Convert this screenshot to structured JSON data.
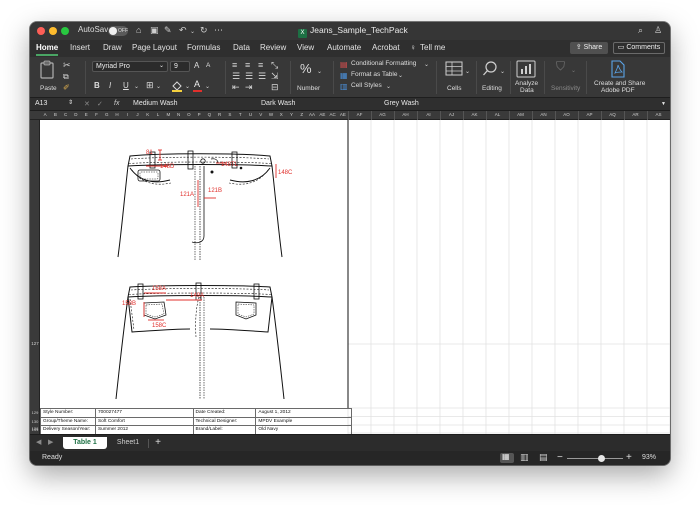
{
  "titlebar": {
    "autosave_label": "AutoSave",
    "autosave_state": "OFF",
    "document_title": "Jeans_Sample_TechPack",
    "window_buttons_colors": [
      "#fe5f57",
      "#febc2e",
      "#28c840"
    ]
  },
  "menu": {
    "tabs": [
      "Home",
      "Insert",
      "Draw",
      "Page Layout",
      "Formulas",
      "Data",
      "Review",
      "View",
      "Automate",
      "Acrobat"
    ],
    "tell_me": "Tell me",
    "share": "Share",
    "comments": "Comments",
    "accent_color": "#4aa564"
  },
  "ribbon": {
    "paste": "Paste",
    "font_name": "Myriad Pro",
    "font_size": "9",
    "bold": "B",
    "italic": "I",
    "underline": "U",
    "grow_font": "A",
    "shrink_font": "A",
    "number": "Number",
    "percent": "%",
    "conditional_formatting": "Conditional Formatting",
    "format_as_table": "Format as Table",
    "cell_styles": "Cell Styles",
    "cells": "Cells",
    "editing": "Editing",
    "analyze_data": [
      "Analyze",
      "Data"
    ],
    "sensitivity": "Sensitivity",
    "create_share": [
      "Create and Share",
      "Adobe PDF"
    ]
  },
  "formula_bar": {
    "name_box": "A13",
    "fx": "fx",
    "cells": [
      "Medium Wash",
      "Dark Wash",
      "Grey Wash"
    ]
  },
  "columns": {
    "left": [
      "A",
      "B",
      "C",
      "D",
      "E",
      "F",
      "G",
      "H",
      "I",
      "J",
      "K",
      "L",
      "M",
      "N",
      "O",
      "P",
      "Q",
      "R",
      "S",
      "T",
      "U",
      "V",
      "W",
      "X",
      "Y",
      "Z",
      "AA",
      "AE",
      "AC",
      "AE"
    ],
    "right": [
      "AF",
      "AG",
      "AH",
      "AI",
      "AJ",
      "AK",
      "AL",
      "AM",
      "AN",
      "AO",
      "AP",
      "AQ",
      "AR",
      "AS"
    ]
  },
  "rows": [
    "127",
    "128",
    "129",
    "130",
    "131"
  ],
  "sketch_labels": {
    "front": [
      "81",
      "148D",
      "148TL",
      "148C",
      "121A",
      "121B"
    ],
    "back": [
      "158A",
      "158B",
      "149A",
      "158C"
    ]
  },
  "spec_table": [
    {
      "label1": "Style Number:",
      "value1": "700027477",
      "label2": "Date Created:",
      "value2": "August 1, 2012"
    },
    {
      "label1": "Group/Theme Name:",
      "value1": "Soft Comfort",
      "label2": "Technical Designer:",
      "value2": "MPDV Example"
    },
    {
      "label1": "Delivery Season/Year:",
      "value1": "Summer 2012",
      "label2": "Brand/Label:",
      "value2": "Old Navy"
    }
  ],
  "sheet_tabs": [
    "Table 1",
    "Sheet1"
  ],
  "add_sheet": "+",
  "status": {
    "ready": "Ready",
    "zoom": "93%",
    "zoom_level": 0.62,
    "minus": "−",
    "plus": "+"
  },
  "annotation_color": "#e0302c"
}
